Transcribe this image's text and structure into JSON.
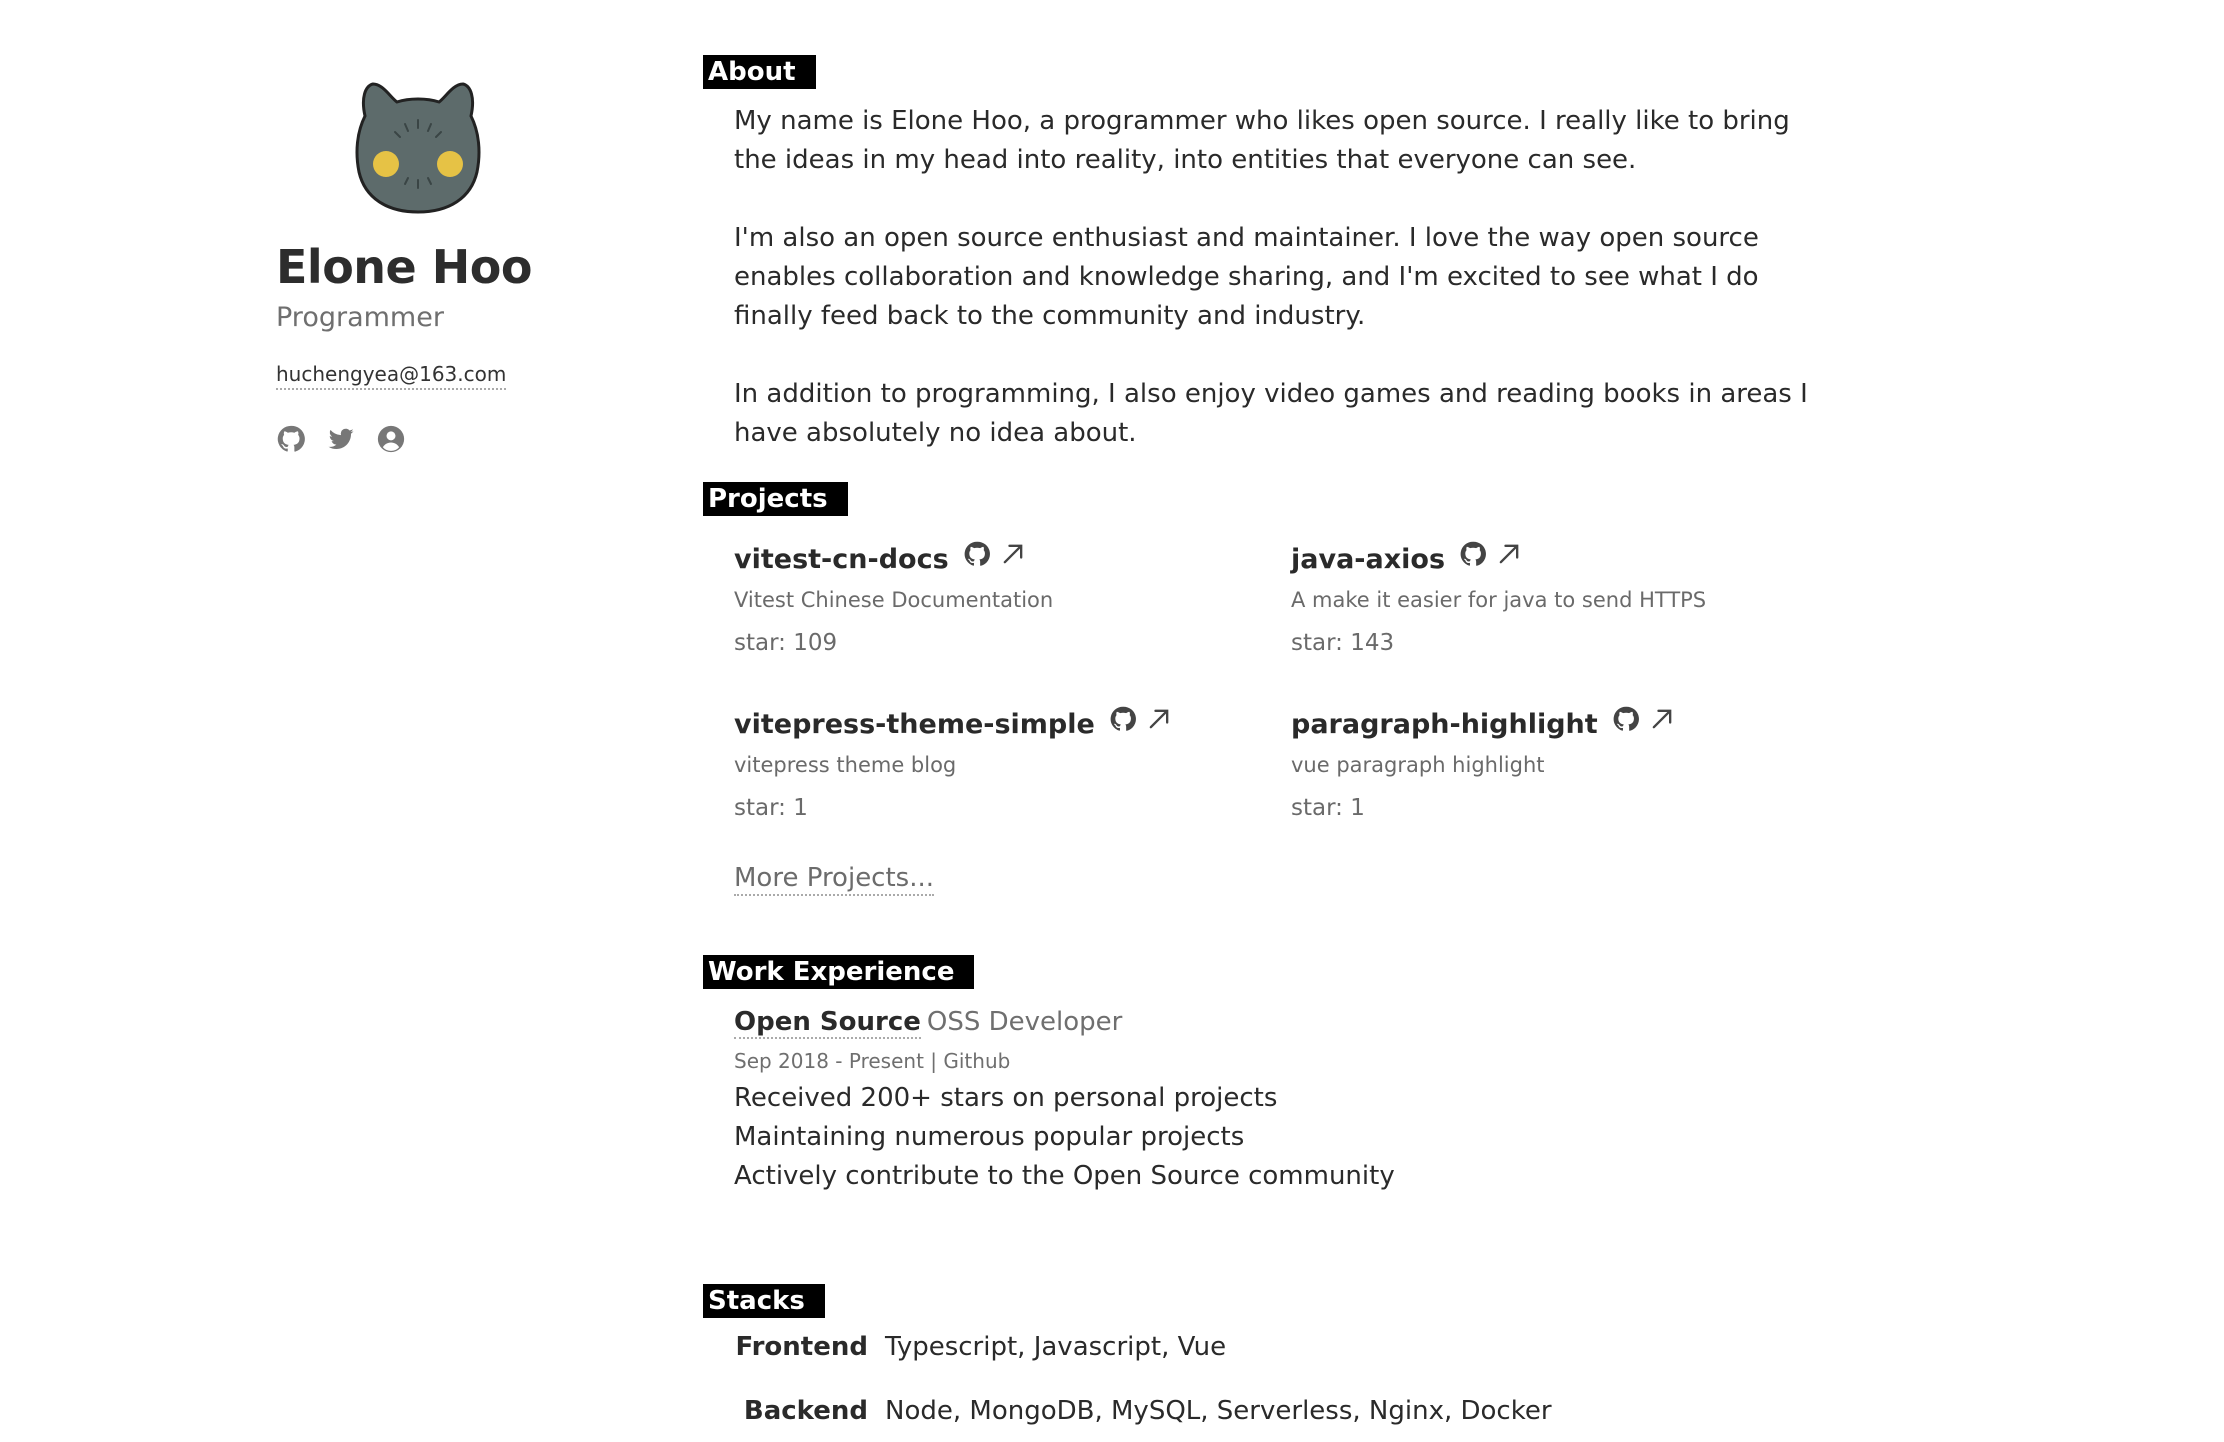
{
  "profile": {
    "name": "Elone Hoo",
    "title": "Programmer",
    "email": "huchengyea@163.com",
    "socials": [
      {
        "icon": "github-icon"
      },
      {
        "icon": "twitter-icon"
      },
      {
        "icon": "user-circle-icon"
      }
    ]
  },
  "about": {
    "heading": "About",
    "paragraphs": [
      "My name is Elone Hoo, a programmer who likes open source. I really like to bring the ideas in my head into reality, into entities that everyone can see.",
      "I'm also an open source enthusiast and maintainer. I love the way open source enables collaboration and knowledge sharing, and I'm excited to see what I do finally feed back to the community and industry.",
      "In addition to programming, I also enjoy video games and reading books in areas I have absolutely no idea about."
    ]
  },
  "projects": {
    "heading": "Projects",
    "items": [
      {
        "name": "vitest-cn-docs",
        "description": "Vitest Chinese Documentation",
        "stars": "star: 109"
      },
      {
        "name": "java-axios",
        "description": "A make it easier for java to send HTTPS",
        "stars": "star: 143"
      },
      {
        "name": "vitepress-theme-simple",
        "description": "vitepress theme blog",
        "stars": "star: 1"
      },
      {
        "name": "paragraph-highlight",
        "description": "vue paragraph highlight",
        "stars": "star: 1"
      }
    ],
    "more_label": "More Projects..."
  },
  "work": {
    "heading": "Work Experience",
    "company": "Open Source",
    "position": "OSS Developer",
    "meta": "Sep 2018 - Present | Github",
    "highlights": [
      "Received 200+ stars on personal projects",
      "Maintaining numerous popular projects",
      "Actively contribute to the Open Source community"
    ]
  },
  "stacks": {
    "heading": "Stacks",
    "rows": [
      {
        "label": "Frontend",
        "value": "Typescript, Javascript, Vue"
      },
      {
        "label": "Backend",
        "value": "Node, MongoDB, MySQL, Serverless, Nginx, Docker"
      }
    ]
  },
  "colors": {
    "accent_bg": "#000000",
    "text": "#2a2a2a",
    "muted": "#6f6f6f",
    "avatar_body": "#5d6b6b",
    "avatar_eyes": "#e6c245"
  }
}
